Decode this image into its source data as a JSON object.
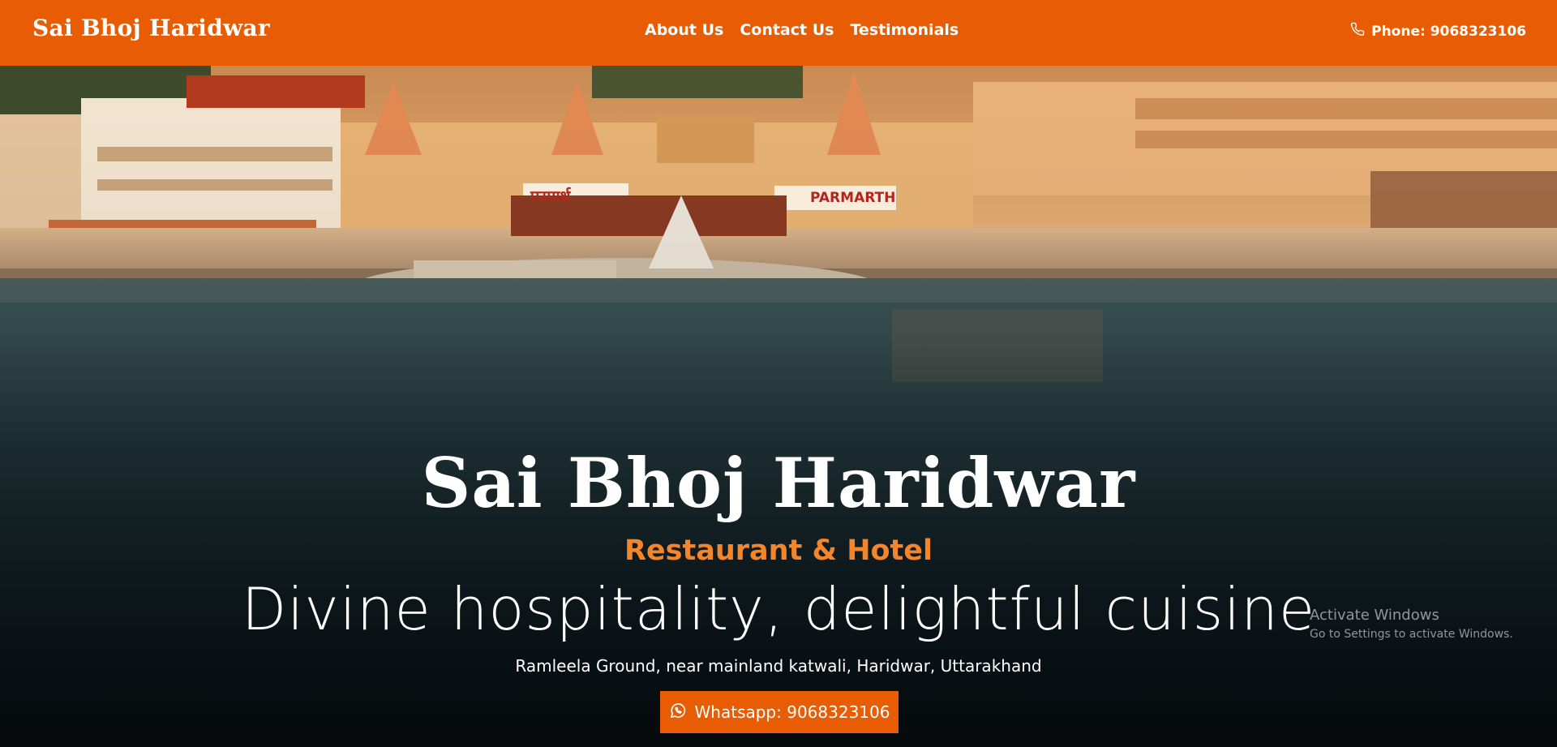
{
  "navbar": {
    "brand": "Sai Bhoj Haridwar",
    "links": [
      "About Us",
      "Contact Us",
      "Testimonials"
    ],
    "phone_label": "Phone: 9068323106",
    "phone_icon": "phone-icon"
  },
  "hero": {
    "signs": [
      "परमार्थ",
      "PARMARTH"
    ],
    "title": "Sai Bhoj Haridwar",
    "subtitle": "Restaurant & Hotel",
    "tagline": "Divine hospitality, delightful cuisine",
    "address": "Ramleela Ground, near mainland katwali, Haridwar, Uttarakhand",
    "whatsapp_label": "Whatsapp: 9068323106",
    "whatsapp_icon": "whatsapp-icon"
  },
  "watermark": {
    "line1": "Activate Windows",
    "line2": "Go to Settings to activate Windows."
  },
  "colors": {
    "primary": "#e85d04",
    "subtitle": "#f3852b",
    "text": "#ffffff"
  }
}
